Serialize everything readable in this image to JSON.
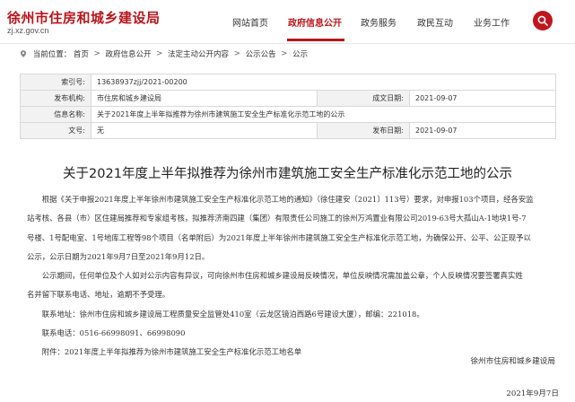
{
  "site": {
    "title": "徐州市住房和城乡建设局",
    "domain": "zj.xz.gov.cn",
    "brand_color": "#b8161c"
  },
  "nav": {
    "items": [
      {
        "label": "网站首页"
      },
      {
        "label": "政府信息公开",
        "active": true
      },
      {
        "label": "政务服务"
      },
      {
        "label": "政民互动"
      },
      {
        "label": "业务工作"
      }
    ],
    "search_icon": "search-icon"
  },
  "breadcrumb": {
    "prefix": "当前位置：",
    "items": [
      "首页",
      "政府信息公开",
      "法定主动公开内容",
      "公示公告",
      "公示"
    ],
    "separator": ">"
  },
  "meta": {
    "index_label": "索引号:",
    "index_value": "13638937zjj/2021-00200",
    "org_label": "发布机构:",
    "org_value": "市住房和城乡建设局",
    "date_label": "成文日期:",
    "date_value": "2021-09-07",
    "name_label": "信息名称:",
    "name_value": "关于2021年度上半年拟推荐为徐州市建筑施工安全生产标准化示范工地的公示",
    "doc_label": "文号:",
    "doc_value": "无",
    "pub_label": "发布日期:",
    "pub_value": "2021-09-07"
  },
  "article": {
    "title": "关于2021年度上半年拟推荐为徐州市建筑施工安全生产标准化示范工地的公示",
    "lines": [
      "根据《关于申报2021年度上半年徐州市建筑施工安全生产标准化示范工地的通知》（徐住建安〔2021〕113号）要求，对申报103个项目，经各安监",
      "站考核、各县（市）区住建局推荐和专家组考核，拟推荐济南四建（集团）有限责任公司施工的徐州万鸿置业有限公司2019-63号大孤山A-1地块1号-7",
      "号楼、1号配电室、1号地库工程等98个项目（名单附后）为2021年度上半年徐州市建筑施工安全生产标准化示范工地，为确保公开、公平、公正现予以",
      "公示，公示日期为2021年9月7日至2021年9月12日。",
      "公示期间，任何单位及个人如对公示内容有异议，可向徐州市住房和城乡建设局反映情况，单位反映情况需加盖公章，个人反映情况要签署真实姓",
      "名并留下联系电话、地址，逾期不予受理。",
      "联系地址：徐州市住房和城乡建设局工程质量安全监管处410室（云龙区镜泊西路6号建设大厦），邮编：221018。",
      "联系电话：0516-66998091、66998090",
      "附件：2021年度上半年拟推荐为徐州市建筑施工安全生产标准化示范工地名单"
    ],
    "signature": "徐州市住房和城乡建设局",
    "sign_date": "2021年9月7日"
  }
}
